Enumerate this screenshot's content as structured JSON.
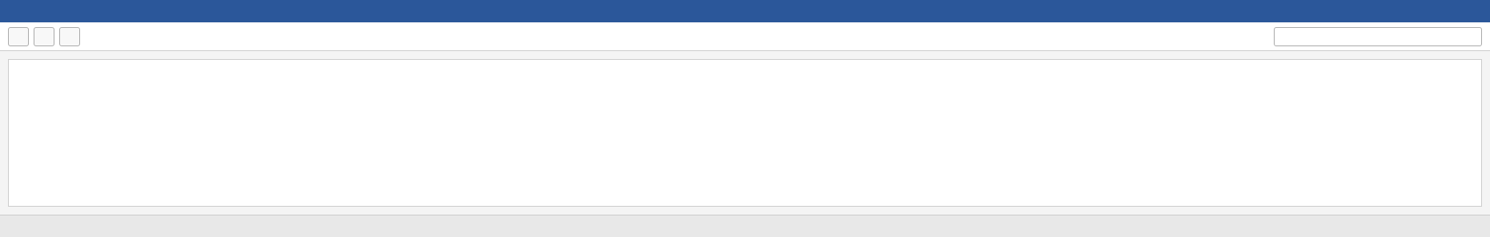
{
  "window": {
    "title": ""
  },
  "toolbar": {
    "buttons": [
      "",
      "",
      ""
    ],
    "search_placeholder": ""
  },
  "main": {
    "content_text": ""
  },
  "statusbar": {
    "text": ""
  }
}
